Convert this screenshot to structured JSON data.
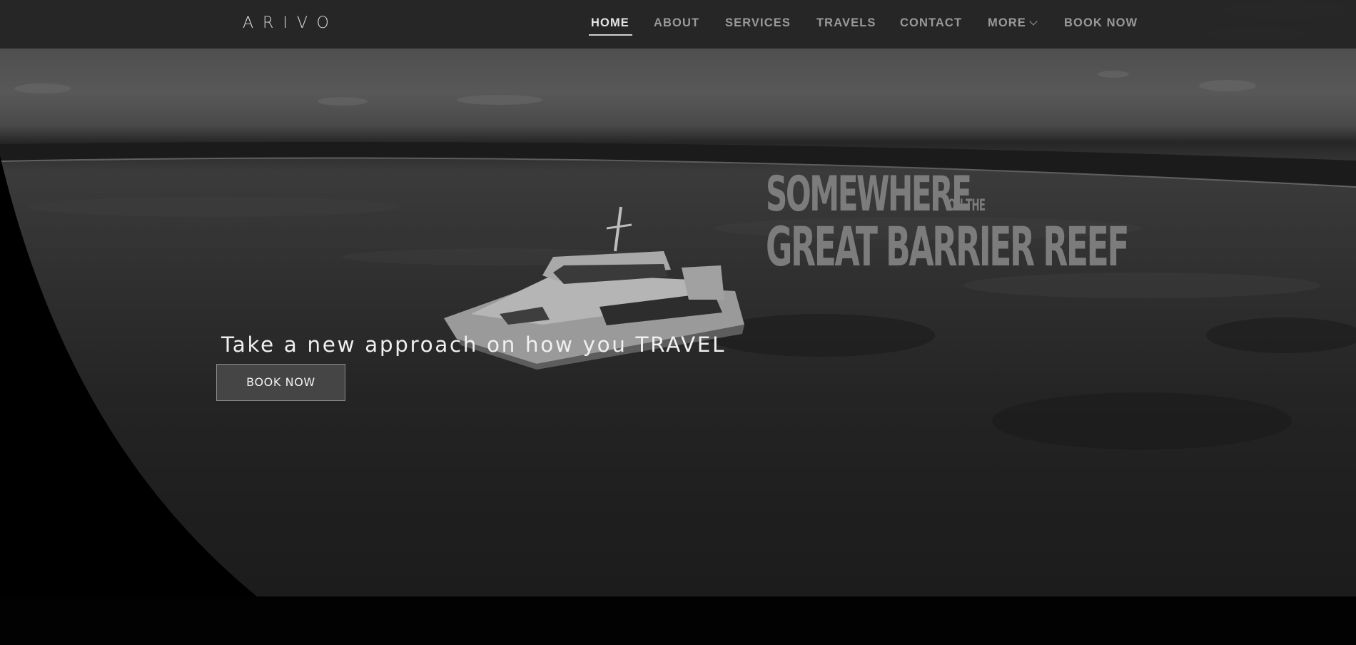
{
  "brand": {
    "logo_text": "ARIVO"
  },
  "nav": {
    "items": [
      {
        "label": "HOME",
        "active": true
      },
      {
        "label": "ABOUT",
        "active": false
      },
      {
        "label": "SERVICES",
        "active": false
      },
      {
        "label": "TRAVELS",
        "active": false
      },
      {
        "label": "CONTACT",
        "active": false
      },
      {
        "label": "MORE",
        "active": false,
        "icon": "chevron-down-icon"
      },
      {
        "label": "BOOK NOW",
        "active": false
      }
    ]
  },
  "hero": {
    "video_overlay": {
      "line1": "SOMEWHERE",
      "line1_small": "ON THE",
      "line2": "GREAT BARRIER REEF"
    },
    "tagline": "Take a new approach on how you TRAVEL",
    "cta_label": "BOOK NOW"
  },
  "colors": {
    "nav_bg": "#242424",
    "text": "#f0f0f0",
    "nav_inactive": "#9a9a9a",
    "page_bg": "#000000"
  }
}
